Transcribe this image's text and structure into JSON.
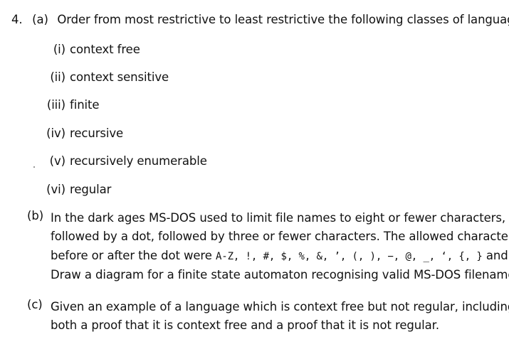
{
  "question": {
    "number": "4.",
    "part_a": {
      "label": "(a)",
      "prompt": "Order from most restrictive to least restrictive the following classes of languages:",
      "items": [
        {
          "label": "(i)",
          "text": "context free"
        },
        {
          "label": "(ii)",
          "text": "context sensitive"
        },
        {
          "label": "(iii)",
          "text": "finite"
        },
        {
          "label": "(iv)",
          "text": "recursive"
        },
        {
          "label": "(v)",
          "text": "recursively enumerable"
        },
        {
          "label": "(vi)",
          "text": "regular"
        }
      ]
    },
    "part_b": {
      "label": "(b)",
      "line1": "In the dark ages MS-DOS used to limit file names to eight or fewer characters,",
      "line2": "followed by a dot, followed by three or fewer characters.  The allowed characters",
      "line3_prefix": "before or after the dot were",
      "line3_chars": "A-Z, !, #, $, %, &, ’, (, ), −, @, _, ‘, {, }",
      "line3_and": "and",
      "line3_tilde": "~",
      "line3_end": ".",
      "line4": "Draw a diagram for a finite state automaton recognising valid MS-DOS filenames."
    },
    "part_c": {
      "label": "(c)",
      "line1": "Given an example of a language which is context free but not regular, including",
      "line2": "both a proof that it is context free and a proof that it is not regular."
    }
  }
}
